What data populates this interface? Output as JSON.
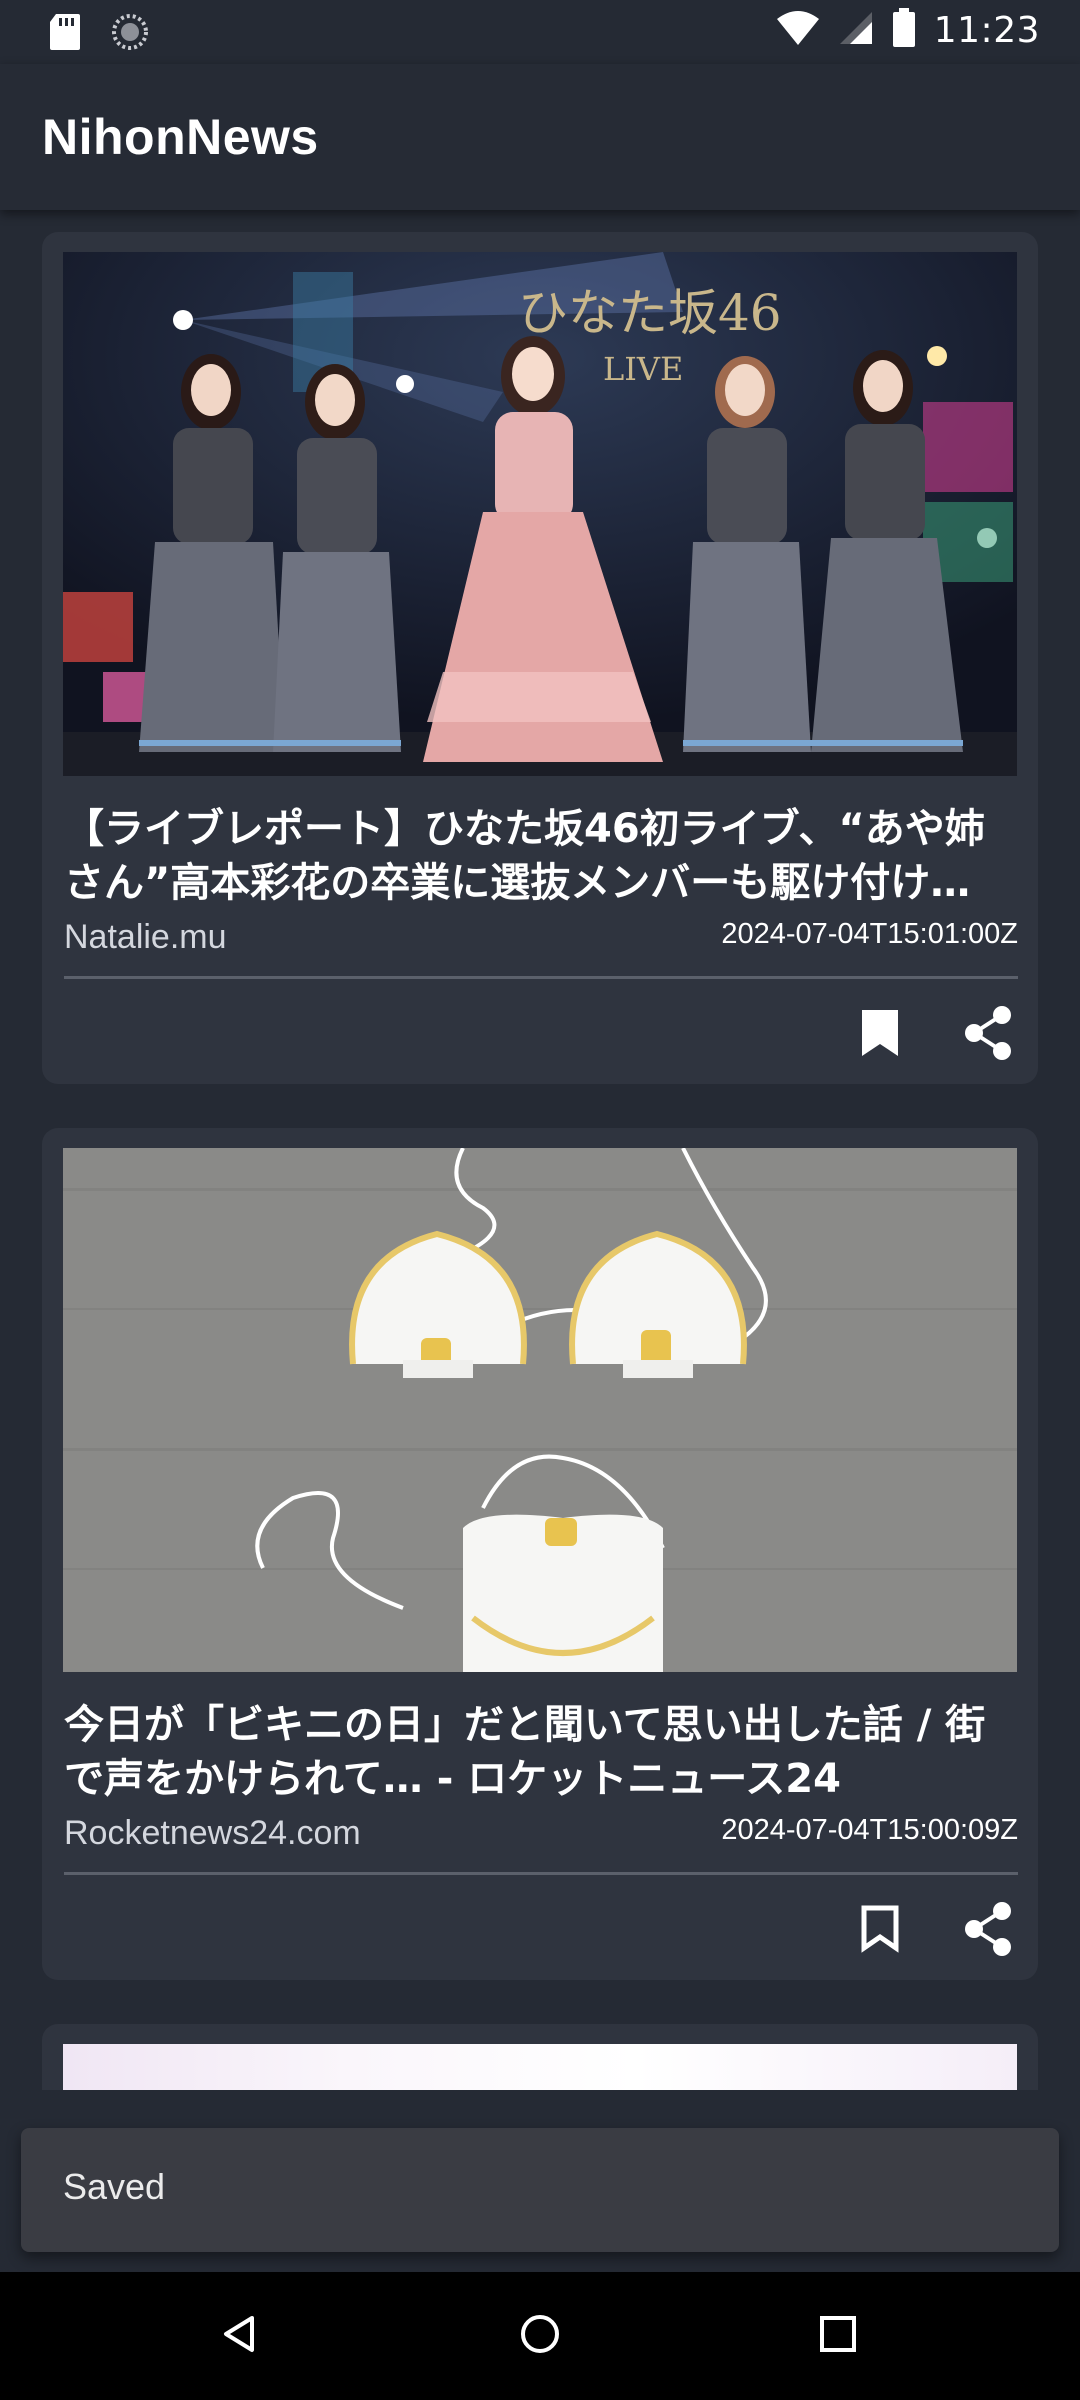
{
  "status_bar": {
    "time": "11:23",
    "left_icons": [
      "sd-card-icon",
      "sync-icon"
    ],
    "right_icons": [
      "wifi-icon",
      "cell-signal-icon",
      "battery-icon"
    ]
  },
  "app": {
    "title": "NihonNews"
  },
  "articles": [
    {
      "title": "【ライブレポート】ひなた坂46初ライブ、“あや姉さん”高本彩花の卒業に選抜メンバーも駆け付け…",
      "source": "Natalie.mu",
      "date": "2024-07-04T15:01:00Z",
      "image_sign": "ひなた坂46",
      "image_sign_sub": "LIVE",
      "bookmarked": true
    },
    {
      "title": "今日が「ビキニの日」だと聞いて思い出した話 / 街で声をかけられて… - ロケットニュース24",
      "source": "Rocketnews24.com",
      "date": "2024-07-04T15:00:09Z",
      "bookmarked": false
    }
  ],
  "snackbar": {
    "message": "Saved"
  },
  "colors": {
    "background": "#252a34",
    "card": "#2f343f",
    "snackbar": "#3a3c43",
    "nav": "#000000"
  }
}
